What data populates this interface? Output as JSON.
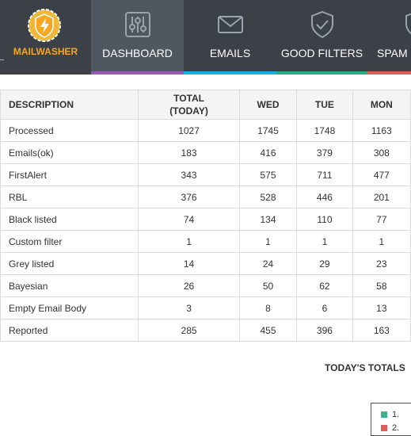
{
  "brand": {
    "name": "MAILWASHER"
  },
  "nav": {
    "tabs": [
      {
        "label": "DASHBOARD",
        "icon": "sliders-icon",
        "color": "#9b59b6",
        "active": true
      },
      {
        "label": "EMAILS",
        "icon": "envelope-icon",
        "color": "#1ab1e2",
        "active": false
      },
      {
        "label": "GOOD FILTERS",
        "icon": "shield-check-icon",
        "color": "#27ae80",
        "active": false
      },
      {
        "label": "SPAM F",
        "icon": "shield-icon",
        "color": "#e05b5b",
        "active": false
      }
    ]
  },
  "table": {
    "headers": [
      "DESCRIPTION",
      "TOTAL\n(TODAY)",
      "WED",
      "TUE",
      "MON"
    ],
    "rows": [
      [
        "Processed",
        "1027",
        "1745",
        "1748",
        "1163"
      ],
      [
        "Emails(ok)",
        "183",
        "416",
        "379",
        "308"
      ],
      [
        "FirstAlert",
        "343",
        "575",
        "711",
        "477"
      ],
      [
        "RBL",
        "376",
        "528",
        "446",
        "201"
      ],
      [
        "Black listed",
        "74",
        "134",
        "110",
        "77"
      ],
      [
        "Custom filter",
        "1",
        "1",
        "1",
        "1"
      ],
      [
        "Grey listed",
        "14",
        "24",
        "29",
        "23"
      ],
      [
        "Bayesian",
        "26",
        "50",
        "62",
        "58"
      ],
      [
        "Empty Email Body",
        "3",
        "8",
        "6",
        "13"
      ],
      [
        "Reported",
        "285",
        "455",
        "396",
        "163"
      ]
    ]
  },
  "totals": {
    "title": "TODAY'S TOTALS",
    "legend": [
      {
        "label": "1.",
        "color": "#3cb48c"
      },
      {
        "label": "2.",
        "color": "#e05b5b"
      }
    ]
  }
}
